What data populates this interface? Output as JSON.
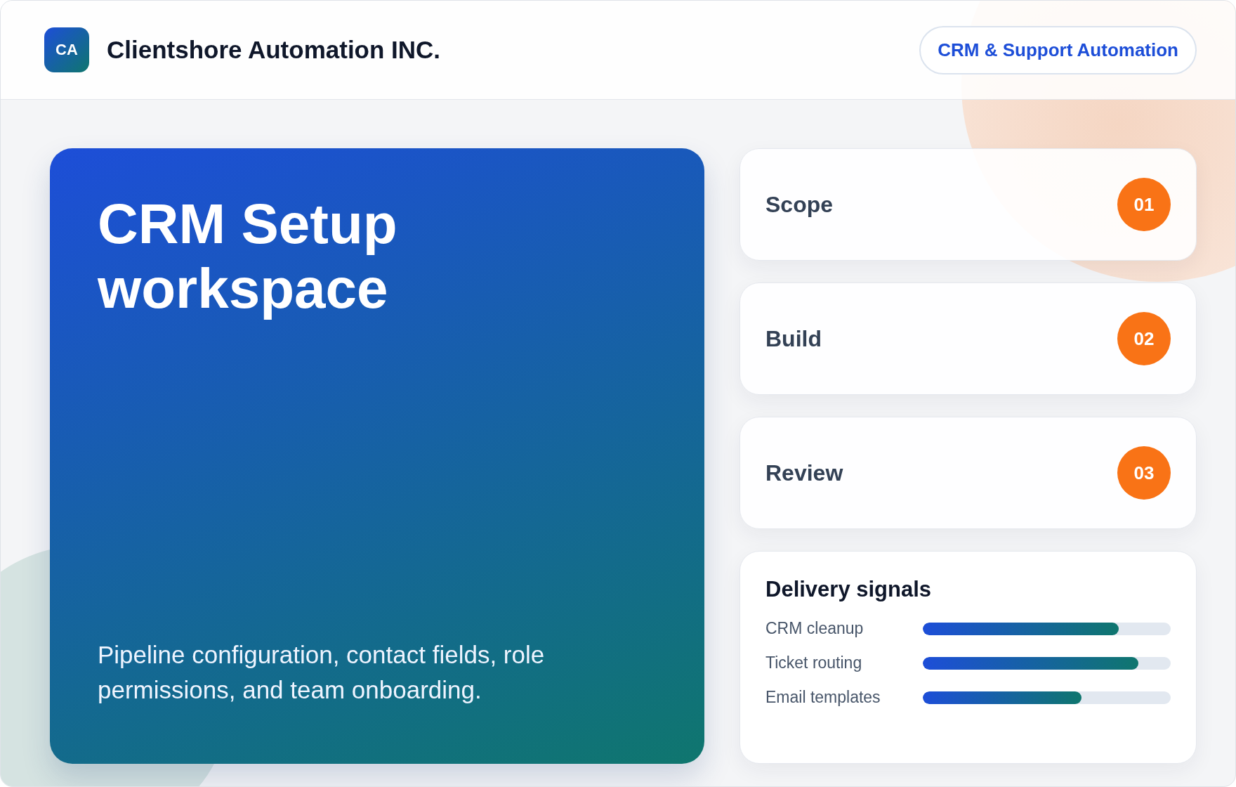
{
  "header": {
    "logo": "CA",
    "company": "Clientshore Automation INC.",
    "badge": "CRM & Support Automation"
  },
  "hero": {
    "title": "CRM Setup workspace",
    "description": "Pipeline configuration, contact fields, role permissions, and team onboarding."
  },
  "steps": [
    {
      "label": "Scope",
      "number": "01"
    },
    {
      "label": "Build",
      "number": "02"
    },
    {
      "label": "Review",
      "number": "03"
    }
  ],
  "signals": {
    "title": "Delivery signals",
    "items": [
      {
        "label": "CRM cleanup",
        "level": 0.79
      },
      {
        "label": "Ticket routing",
        "level": 0.87
      },
      {
        "label": "Email templates",
        "level": 0.64
      }
    ]
  }
}
